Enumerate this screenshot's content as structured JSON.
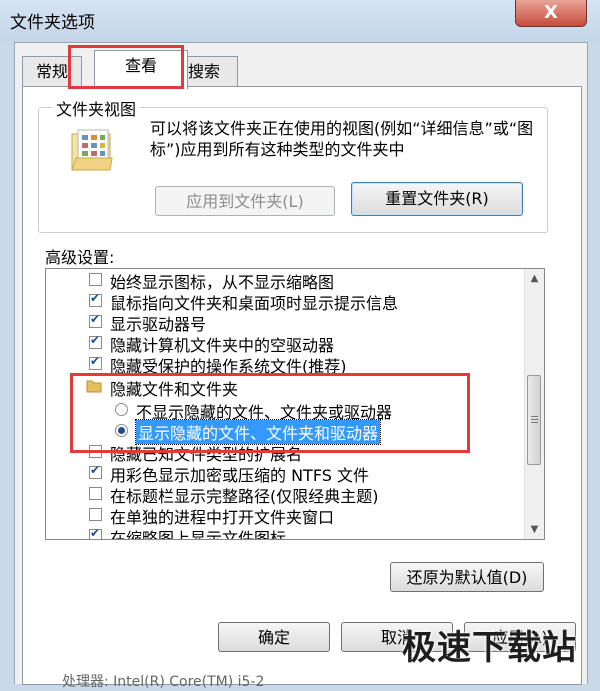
{
  "window": {
    "title": "文件夹选项",
    "close_glyph": "X"
  },
  "tabs": [
    {
      "label": "常规"
    },
    {
      "label": "查看"
    },
    {
      "label": "搜索"
    }
  ],
  "folder_views": {
    "group_title": "文件夹视图",
    "description": "可以将该文件夹正在使用的视图(例如“详细信息”或“图标”)应用到所有这种类型的文件夹中",
    "apply_button": "应用到文件夹(L)",
    "reset_button": "重置文件夹(R)"
  },
  "advanced": {
    "label": "高级设置:",
    "items": [
      {
        "type": "checkbox",
        "checked": false,
        "label": "始终显示图标，从不显示缩略图"
      },
      {
        "type": "checkbox",
        "checked": true,
        "label": "鼠标指向文件夹和桌面项时显示提示信息"
      },
      {
        "type": "checkbox",
        "checked": true,
        "label": "显示驱动器号"
      },
      {
        "type": "checkbox",
        "checked": true,
        "label": "隐藏计算机文件夹中的空驱动器"
      },
      {
        "type": "checkbox",
        "checked": true,
        "label": "隐藏受保护的操作系统文件(推荐)"
      },
      {
        "type": "folder",
        "label": "隐藏文件和文件夹"
      },
      {
        "type": "radio",
        "checked": false,
        "label": "不显示隐藏的文件、文件夹或驱动器"
      },
      {
        "type": "radio",
        "checked": true,
        "selected": true,
        "label": "显示隐藏的文件、文件夹和驱动器"
      },
      {
        "type": "checkbox",
        "checked": false,
        "label": "隐藏已知文件类型的扩展名"
      },
      {
        "type": "checkbox",
        "checked": true,
        "label": "用彩色显示加密或压缩的 NTFS 文件"
      },
      {
        "type": "checkbox",
        "checked": false,
        "label": "在标题栏显示完整路径(仅限经典主题)"
      },
      {
        "type": "checkbox",
        "checked": false,
        "label": "在单独的进程中打开文件夹窗口"
      },
      {
        "type": "checkbox",
        "checked": true,
        "label": "在缩略图上显示文件图标"
      }
    ],
    "restore_button": "还原为默认值(D)"
  },
  "footer": {
    "ok_button": "确定",
    "cancel_button": "取消",
    "apply_button": "应用(A)"
  },
  "watermark": "极速下载站",
  "background_text": "处理器: Intel(R) Core(TM) i5-2"
}
